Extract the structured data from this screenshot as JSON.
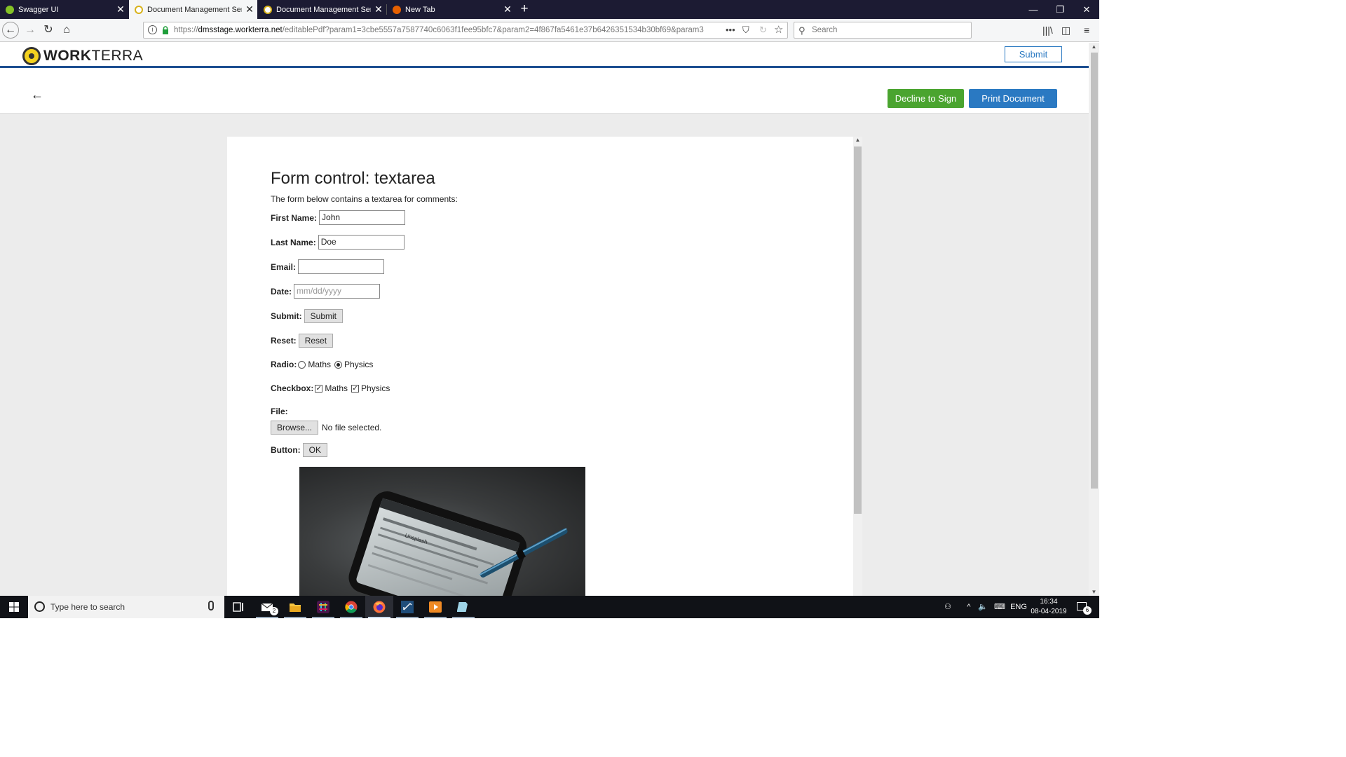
{
  "browser": {
    "tabs": [
      {
        "title": "Swagger UI",
        "active": false,
        "favicon_color": "#85c226"
      },
      {
        "title": "Document Management Servic",
        "active": true,
        "favicon_color": "#d8b21a"
      },
      {
        "title": "Document Management Servic",
        "active": false,
        "favicon_color": "#d8b21a"
      },
      {
        "title": "New Tab",
        "active": false,
        "favicon_color": "#e66000"
      }
    ],
    "new_tab": "+",
    "url_host": "dmsstage.workterra.net",
    "url_prefix": "https://",
    "url_path": "/editablePdf?param1=3cbe5557a7587740c6063f1fee95bfc7&param2=4f867fa5461e37b6426351534b30bf69&param3",
    "search_placeholder": "Search",
    "window_controls": {
      "minimize": "—",
      "restore": "❐",
      "close": "✕"
    }
  },
  "app": {
    "logo": {
      "bold": "WORK",
      "light": "TERRA"
    },
    "submit_label": "Submit",
    "decline_label": "Decline to Sign",
    "print_label": "Print Document",
    "back_icon": "←",
    "colors": {
      "header_rule": "#1d4f91",
      "accent_blue": "#2a79c2",
      "accent_green": "#4aa42f"
    }
  },
  "document": {
    "title": "Form control: textarea",
    "description": "The form below contains a textarea for comments:",
    "fields": {
      "first_name": {
        "label": "First Name:",
        "value": "John"
      },
      "last_name": {
        "label": "Last Name:",
        "value": "Doe"
      },
      "email": {
        "label": "Email:",
        "value": ""
      },
      "date": {
        "label": "Date:",
        "placeholder": "mm/dd/yyyy"
      },
      "submit": {
        "label": "Submit:",
        "button": "Submit"
      },
      "reset": {
        "label": "Reset:",
        "button": "Reset"
      },
      "radio": {
        "label": "Radio:",
        "options": [
          "Maths",
          "Physics"
        ],
        "selected": "Physics"
      },
      "checkbox": {
        "label": "Checkbox:",
        "options": [
          "Maths",
          "Physics"
        ],
        "checked": [
          "Maths",
          "Physics"
        ]
      },
      "file": {
        "label": "File:",
        "button": "Browse...",
        "status": "No file selected."
      },
      "button": {
        "label": "Button:",
        "button": "OK"
      }
    },
    "photo": {
      "screen_title": "Unsplash"
    }
  },
  "taskbar": {
    "search_placeholder": "Type here to search",
    "mail_badge": "2",
    "language": "ENG",
    "time": "16:34",
    "date": "08-04-2019",
    "notification_count": "6"
  }
}
